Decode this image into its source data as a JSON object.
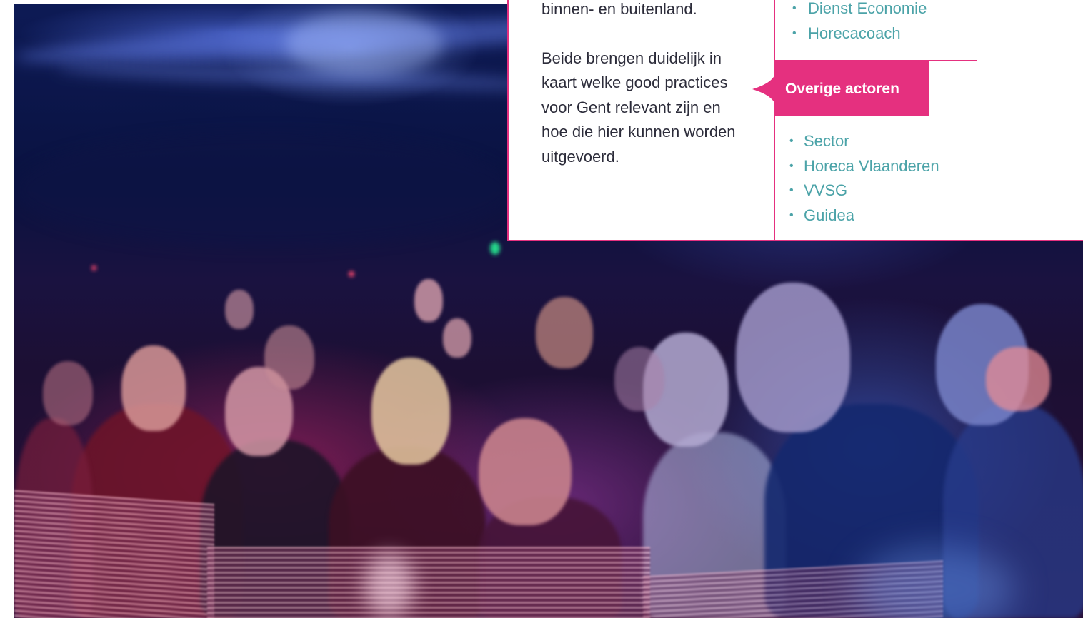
{
  "intro": {
    "paragraph_1": "binnen- en buitenland.",
    "paragraph_2": "Beide brengen duidelijk in kaart welke good practices voor Gent relevant zijn en hoe die hier kunnen worden uitgevoerd."
  },
  "stad_gent_list": [
    "Dienst Economie",
    "Horecacoach"
  ],
  "overige_actoren": {
    "heading": "Overige actoren",
    "items": [
      "Sector",
      "Horeca Vlaanderen",
      "VVSG",
      "Guidea"
    ]
  },
  "bullet_symbol": "•",
  "colors": {
    "accent_pink": "#e5307f",
    "list_teal": "#4ba3a8",
    "body_text": "#2c2c3a"
  }
}
